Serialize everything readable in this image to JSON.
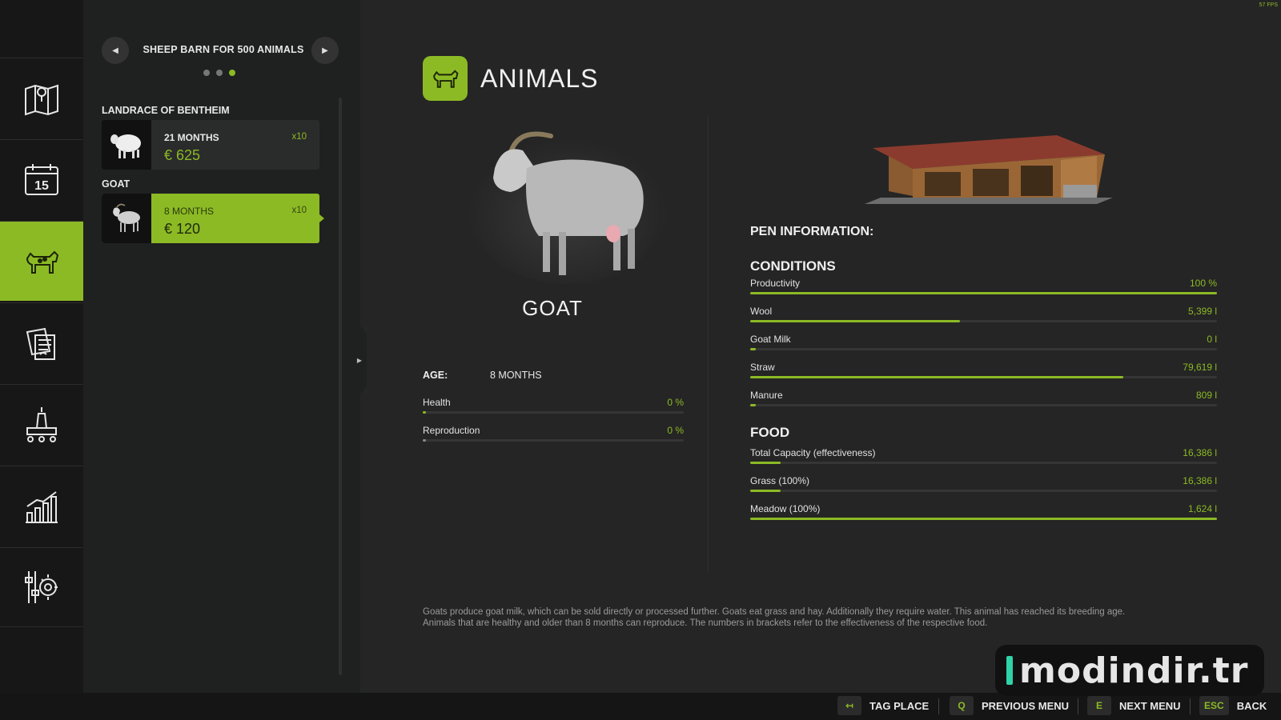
{
  "fps": "57 FPS",
  "rail": {
    "items": [
      {
        "icon": "map-icon"
      },
      {
        "icon": "calendar-icon",
        "day": "15"
      },
      {
        "icon": "animals-icon"
      },
      {
        "icon": "contracts-icon"
      },
      {
        "icon": "production-icon"
      },
      {
        "icon": "statistics-icon"
      },
      {
        "icon": "settings-icon"
      }
    ],
    "active_index": 2
  },
  "list": {
    "title": "SHEEP BARN FOR 500 ANIMALS",
    "page_count": 3,
    "active_page": 3,
    "groups": [
      {
        "label": "LANDRACE OF BENTHEIM",
        "age": "21 MONTHS",
        "price": "€ 625",
        "count": "x10"
      },
      {
        "label": "GOAT",
        "age": "8 MONTHS",
        "price": "€ 120",
        "count": "x10"
      }
    ]
  },
  "main": {
    "title": "ANIMALS",
    "animal_name": "GOAT",
    "age_label": "AGE:",
    "age_value": "8 MONTHS",
    "animal_stats": [
      {
        "label": "Health",
        "value": "0 %",
        "fraction": 0.0
      },
      {
        "label": "Reproduction",
        "value": "0 %",
        "fraction": 0.0
      }
    ],
    "pen_info_title": "PEN INFORMATION:",
    "conditions_title": "CONDITIONS",
    "conditions": [
      {
        "label": "Productivity",
        "value": "100 %",
        "fraction": 1.0
      },
      {
        "label": "Wool",
        "value": "5,399 l",
        "fraction": 0.45
      },
      {
        "label": "Goat Milk",
        "value": "0 l",
        "fraction": 0.0
      },
      {
        "label": "Straw",
        "value": "79,619 l",
        "fraction": 0.8
      },
      {
        "label": "Manure",
        "value": "809 l",
        "fraction": 0.01
      }
    ],
    "food_title": "FOOD",
    "food": [
      {
        "label": "Total Capacity (effectiveness)",
        "value": "16,386 l",
        "fraction": 0.065
      },
      {
        "label": "Grass (100%)",
        "value": "16,386 l",
        "fraction": 0.065
      },
      {
        "label": "Meadow (100%)",
        "value": "1,624 l",
        "fraction": 1.0
      }
    ],
    "description": "Goats produce goat milk, which can be sold directly or processed further. Goats eat grass and hay. Additionally they require water. This animal has reached its breeding age. Animals that are healthy and older than 8 months can reproduce. The numbers in brackets refer to the effectiveness of the respective food."
  },
  "bottom": {
    "hints": [
      {
        "key": "↤",
        "label": "TAG PLACE"
      },
      {
        "key": "Q",
        "label": "PREVIOUS MENU"
      },
      {
        "key": "E",
        "label": "NEXT MENU"
      },
      {
        "key": "ESC",
        "label": "BACK"
      }
    ]
  },
  "watermark": "modindir.tr",
  "colors": {
    "accent": "#8cba25",
    "background": "#252525",
    "panel": "#1f2020",
    "rail": "#171717"
  }
}
